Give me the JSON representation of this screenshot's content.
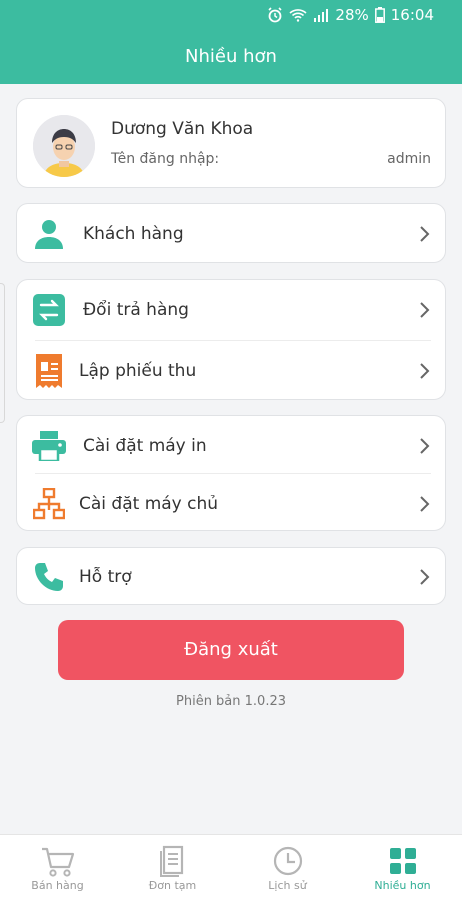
{
  "status_bar": {
    "battery": "28%",
    "time": "16:04",
    "icons": [
      "alarm-icon",
      "wifi-icon",
      "signal-icon",
      "battery-icon"
    ]
  },
  "header": {
    "title": "Nhiều hơn"
  },
  "profile": {
    "name": "Dương Văn Khoa",
    "username_label": "Tên đăng nhập:",
    "username": "admin"
  },
  "menu": {
    "customers": "Khách hàng",
    "returns": "Đổi trả hàng",
    "receipt": "Lập phiếu thu",
    "printer": "Cài đặt máy in",
    "server": "Cài đặt máy chủ",
    "support": "Hỗ trợ"
  },
  "logout_label": "Đăng xuất",
  "version": "Phiên bản 1.0.23",
  "tabs": [
    {
      "label": "Bán hàng",
      "icon": "cart-icon",
      "active": false
    },
    {
      "label": "Đơn tạm",
      "icon": "document-icon",
      "active": false
    },
    {
      "label": "Lịch sử",
      "icon": "clock-icon",
      "active": false
    },
    {
      "label": "Nhiều hơn",
      "icon": "grid-icon",
      "active": true
    }
  ],
  "colors": {
    "primary": "#3cbca0",
    "logout": "#f05462",
    "orange": "#ef7b2e"
  }
}
